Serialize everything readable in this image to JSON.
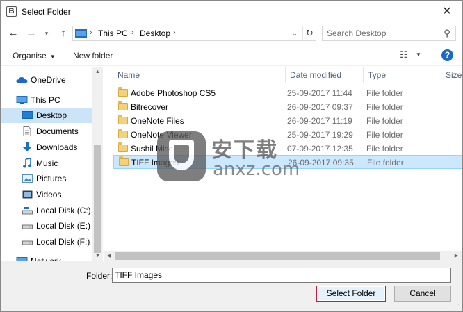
{
  "window": {
    "title": "Select Folder",
    "app_icon_letter": "B",
    "close_glyph": "✕"
  },
  "nav": {
    "back_glyph": "←",
    "forward_glyph": "→",
    "recent_glyph": "▾",
    "up_glyph": "↑"
  },
  "address": {
    "crumbs": [
      "This PC",
      "Desktop"
    ],
    "separator": "›",
    "dropdown_glyph": "⌄",
    "refresh_glyph": "↻"
  },
  "search": {
    "placeholder": "Search Desktop",
    "icon_glyph": "⚲"
  },
  "toolbar": {
    "organise_label": "Organise",
    "organise_caret": "▼",
    "new_folder_label": "New folder",
    "view_glyph": "☷",
    "view_caret": "▼",
    "help_glyph": "?"
  },
  "sidebar": {
    "items": [
      {
        "label": "OneDrive",
        "icon": "onedrive-icon"
      },
      {
        "label": "This PC",
        "icon": "pc-icon"
      },
      {
        "label": "Desktop",
        "icon": "desktop-icon"
      },
      {
        "label": "Documents",
        "icon": "documents-icon"
      },
      {
        "label": "Downloads",
        "icon": "downloads-icon"
      },
      {
        "label": "Music",
        "icon": "music-icon"
      },
      {
        "label": "Pictures",
        "icon": "pictures-icon"
      },
      {
        "label": "Videos",
        "icon": "videos-icon"
      },
      {
        "label": "Local Disk (C:)",
        "icon": "disk-c-icon"
      },
      {
        "label": "Local Disk (E:)",
        "icon": "disk-icon"
      },
      {
        "label": "Local Disk (F:)",
        "icon": "disk-icon"
      },
      {
        "label": "Network",
        "icon": "network-icon"
      }
    ],
    "selected": "Desktop"
  },
  "table": {
    "columns": [
      "Name",
      "Date modified",
      "Type",
      "Size"
    ],
    "sort_glyph": "^",
    "rows": [
      {
        "name": "Adobe Photoshop CS5",
        "date": "25-09-2017 11:44",
        "type": "File folder"
      },
      {
        "name": "Bitrecover",
        "date": "26-09-2017 09:37",
        "type": "File folder"
      },
      {
        "name": "OneNote Files",
        "date": "26-09-2017 11:19",
        "type": "File folder"
      },
      {
        "name": "OneNote Viewer",
        "date": "25-09-2017 19:29",
        "type": "File folder"
      },
      {
        "name": "Sushil Misc",
        "date": "07-09-2017 12:35",
        "type": "File folder"
      },
      {
        "name": "TIFF Images",
        "date": "26-09-2017 09:35",
        "type": "File folder"
      }
    ],
    "selected": "TIFF Images"
  },
  "scroll": {
    "up": "▲",
    "down": "▼",
    "left": "◀",
    "right": "▶"
  },
  "footer": {
    "folder_label": "Folder:",
    "folder_value": "TIFF Images",
    "select_label": "Select Folder",
    "cancel_label": "Cancel",
    "grip_glyph": "⋰"
  },
  "watermark": {
    "cn_text": "安下载",
    "en_text": "anxz.com"
  },
  "colors": {
    "selection_bg": "#cce8ff",
    "nav_selected_bg": "#cce4f7",
    "accent_button_border": "#c21e3a",
    "help_blue": "#1b6ac9",
    "folder_yellow": "#f3d27a"
  }
}
